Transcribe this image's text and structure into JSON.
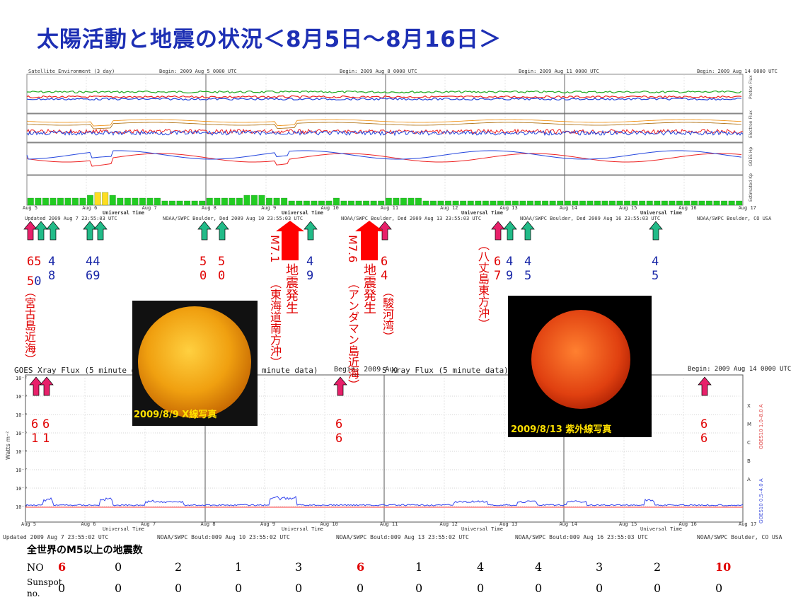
{
  "title": "太陽活動と地震の状況＜8月5日～8月16日＞",
  "panel_top": {
    "header_left": "Satellite Environment (3 day)",
    "header_begins": [
      "Begin: 2009 Aug 5 0000 UTC",
      "Begin: 2009 Aug 8 0000 UTC",
      "Begin: 2009 Aug 11 0000 UTC",
      "Begin: 2009 Aug 14 0000 UTC"
    ],
    "axis_labels": [
      "Proton Flux",
      "Electron Flux",
      "GOES Hp",
      "Estimated Kp"
    ],
    "xaxis_title": "Universal Time",
    "day_ticks": [
      "Aug 5",
      "Aug 6",
      "Aug 7",
      "Aug 8",
      "Aug 9",
      "Aug 10",
      "Aug 11",
      "Aug 12",
      "Aug 13",
      "Aug 14",
      "Aug 15",
      "Aug 16",
      "Aug 17"
    ],
    "footers": [
      "Updated 2009 Aug 7 23:55:03 UTC",
      "NOAA/SWPC Boulder, Ded 2009 Aug 10 23:55:03 UTC",
      "NOAA/SWPC Boulder, Ded 2009 Aug 13 23:55:03 UTC",
      "NOAA/SWPC Boulder, Ded 2009 Aug 16 23:55:03 UTC",
      "NOAA/SWPC Boulder, CO USA"
    ]
  },
  "panel_xray": {
    "header": "GOES Xray Flux (5 minute data)",
    "header2": "minute data)",
    "header3": "S Xray Flux (5 minute data)",
    "begin_label": "Begin: 2009 Aug 14 0000 UTC",
    "begin_partial": "Begin: 2009 Aug",
    "ylabel": "Watts m⁻²",
    "yticks": [
      "10⁻²",
      "10⁻³",
      "10⁻⁴",
      "10⁻⁵",
      "10⁻⁶",
      "10⁻⁷",
      "10⁻⁸",
      "10⁻⁹"
    ],
    "class_letters": [
      "X",
      "M",
      "C",
      "B",
      "A"
    ],
    "right_label_red": "GOES10 1.0–8.0 A",
    "right_label_blue": "GOES10 0.5–4.0 A",
    "footers": [
      "Updated 2009 Aug 7 23:55:02 UTC",
      "NOAA/SWPC Bould:009 Aug 10 23:55:02 UTC",
      "NOAA/SWPC Bould:009 Aug 13 23:55:02 UTC",
      "NOAA/SWPC Bould:009 Aug 16 23:55:03 UTC",
      "NOAA/SWPC Boulder, CO USA"
    ]
  },
  "sun_images": [
    {
      "caption": "2009/8/9 X線写真"
    },
    {
      "caption": "2009/8/13 紫外線写真"
    }
  ],
  "quake_labels": {
    "m71_label": "M7.1",
    "m71_text": "地震発生",
    "m71_place": "（東海道南方沖）",
    "m76_label": "M7.6",
    "m76_text": "地震発生",
    "m76_place": "（アンダマン島近海）",
    "miyako": "（宮古島近海）",
    "suruga": "（駿河湾）",
    "hachijo": "（八丈島東方沖）"
  },
  "table": {
    "heading": "全世界のM5以上の地震数",
    "row1_label": "NO",
    "row2_label": "Sunspot",
    "row2_label2": "no.",
    "quake_counts": [
      "6",
      "0",
      "2",
      "1",
      "3",
      "6",
      "1",
      "4",
      "4",
      "3",
      "2",
      "10"
    ],
    "sunspots": [
      "0",
      "0",
      "0",
      "0",
      "0",
      "0",
      "0",
      "0",
      "0",
      "0",
      "0",
      "0"
    ]
  },
  "chart_data": [
    {
      "type": "bar",
      "title": "Satellite Environment (3 day)",
      "ylabel": "Estimated Kp",
      "xlabel": "Universal Time",
      "categories": [
        "Aug 5",
        "Aug 6",
        "Aug 7",
        "Aug 8",
        "Aug 9",
        "Aug 10",
        "Aug 11",
        "Aug 12",
        "Aug 13",
        "Aug 14",
        "Aug 15",
        "Aug 16"
      ],
      "kp_values": [
        2,
        2,
        2,
        2,
        2,
        2,
        2,
        2,
        3,
        4,
        4,
        3,
        2,
        2,
        2,
        2,
        2,
        2,
        1,
        1,
        1,
        1,
        1,
        1,
        2,
        2,
        2,
        2,
        2,
        3,
        3,
        3,
        2,
        2,
        2,
        1,
        1,
        1,
        1,
        1,
        1,
        2,
        1,
        1,
        1,
        1,
        1,
        1,
        2,
        2,
        2,
        2,
        2,
        1,
        1,
        1,
        1,
        1,
        1,
        1,
        1,
        1,
        1,
        1,
        1,
        1,
        1,
        1,
        1,
        1,
        1,
        1,
        1,
        1,
        1,
        1,
        1,
        1,
        1,
        1,
        1,
        1,
        1,
        1,
        1,
        1,
        1,
        1,
        1,
        1,
        1,
        1,
        1,
        1,
        1,
        1
      ],
      "colors": {
        "quiet": "#22cc22",
        "active": "#ffdd22"
      }
    },
    {
      "type": "line",
      "title": "GOES Xray Flux (5 minute data)",
      "ylabel": "Watts m⁻²",
      "ylim": [
        "1e-9",
        "1e-2"
      ],
      "scale": "log",
      "x": [
        "Aug 5",
        "Aug 6",
        "Aug 7",
        "Aug 8",
        "Aug 9",
        "Aug 10",
        "Aug 11",
        "Aug 12",
        "Aug 13",
        "Aug 14",
        "Aug 15",
        "Aug 16",
        "Aug 17"
      ],
      "series": [
        {
          "name": "GOES10 1.0–8.0 A",
          "color": "#ff5050"
        },
        {
          "name": "GOES10 0.5–4.0 A",
          "color": "#3344ee"
        }
      ]
    }
  ],
  "colors": {
    "title": "#1d2fb4",
    "red_text": "#e00000",
    "blue_text": "#1a28a8",
    "arrow_green": "#22bb88",
    "arrow_pink": "#e8206a",
    "arrow_red": "#ff0000"
  }
}
